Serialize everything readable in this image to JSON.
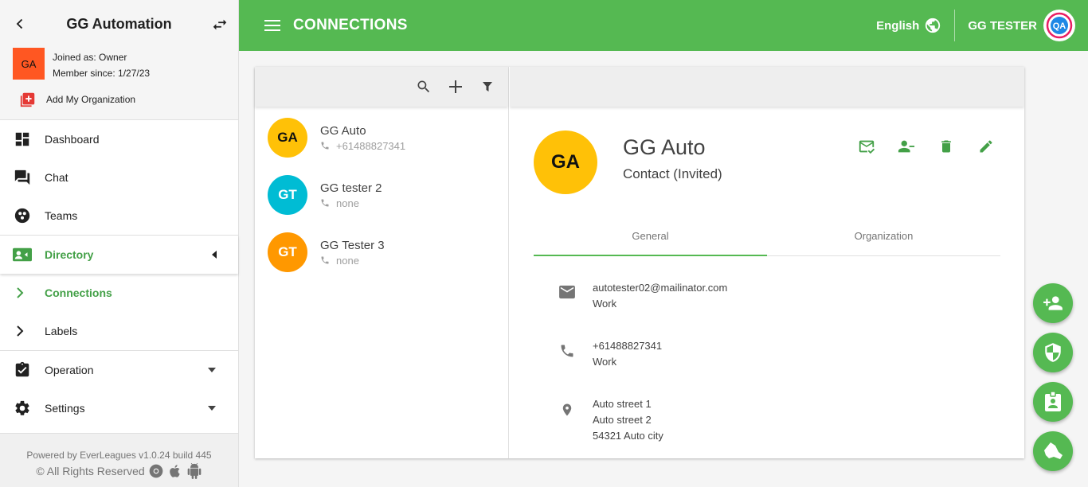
{
  "sidebar": {
    "org_title": "GG Automation",
    "org_avatar": "GA",
    "joined_as": "Joined as: Owner",
    "member_since": "Member since: 1/27/23",
    "add_org": "Add My Organization",
    "nav": {
      "dashboard": "Dashboard",
      "chat": "Chat",
      "teams": "Teams",
      "directory": "Directory",
      "connections": "Connections",
      "labels": "Labels",
      "operation": "Operation",
      "settings": "Settings"
    },
    "footer": {
      "powered": "Powered by EverLeagues v1.0.24 build 445",
      "rights": "© All Rights Reserved"
    }
  },
  "topbar": {
    "title": "CONNECTIONS",
    "language": "English",
    "user": "GG TESTER",
    "brand_color": "#55b952"
  },
  "contacts": [
    {
      "initials": "GA",
      "name": "GG Auto",
      "phone": "+61488827341",
      "color": "#ffc107",
      "text_color": "#111111"
    },
    {
      "initials": "GT",
      "name": "GG tester 2",
      "phone": "none",
      "color": "#00bcd4",
      "text_color": "#ffffff"
    },
    {
      "initials": "GT",
      "name": "GG Tester 3",
      "phone": "none",
      "color": "#ff9800",
      "text_color": "#ffffff"
    }
  ],
  "detail": {
    "initials": "GA",
    "name": "GG Auto",
    "status": "Contact (Invited)",
    "tabs": {
      "general": "General",
      "organization": "Organization"
    },
    "email": "autotester02@mailinator.com",
    "email_type": "Work",
    "phone": "+61488827341",
    "phone_type": "Work",
    "address_line1": "Auto street 1",
    "address_line2": "Auto street 2",
    "address_line3": "54321 Auto city"
  }
}
